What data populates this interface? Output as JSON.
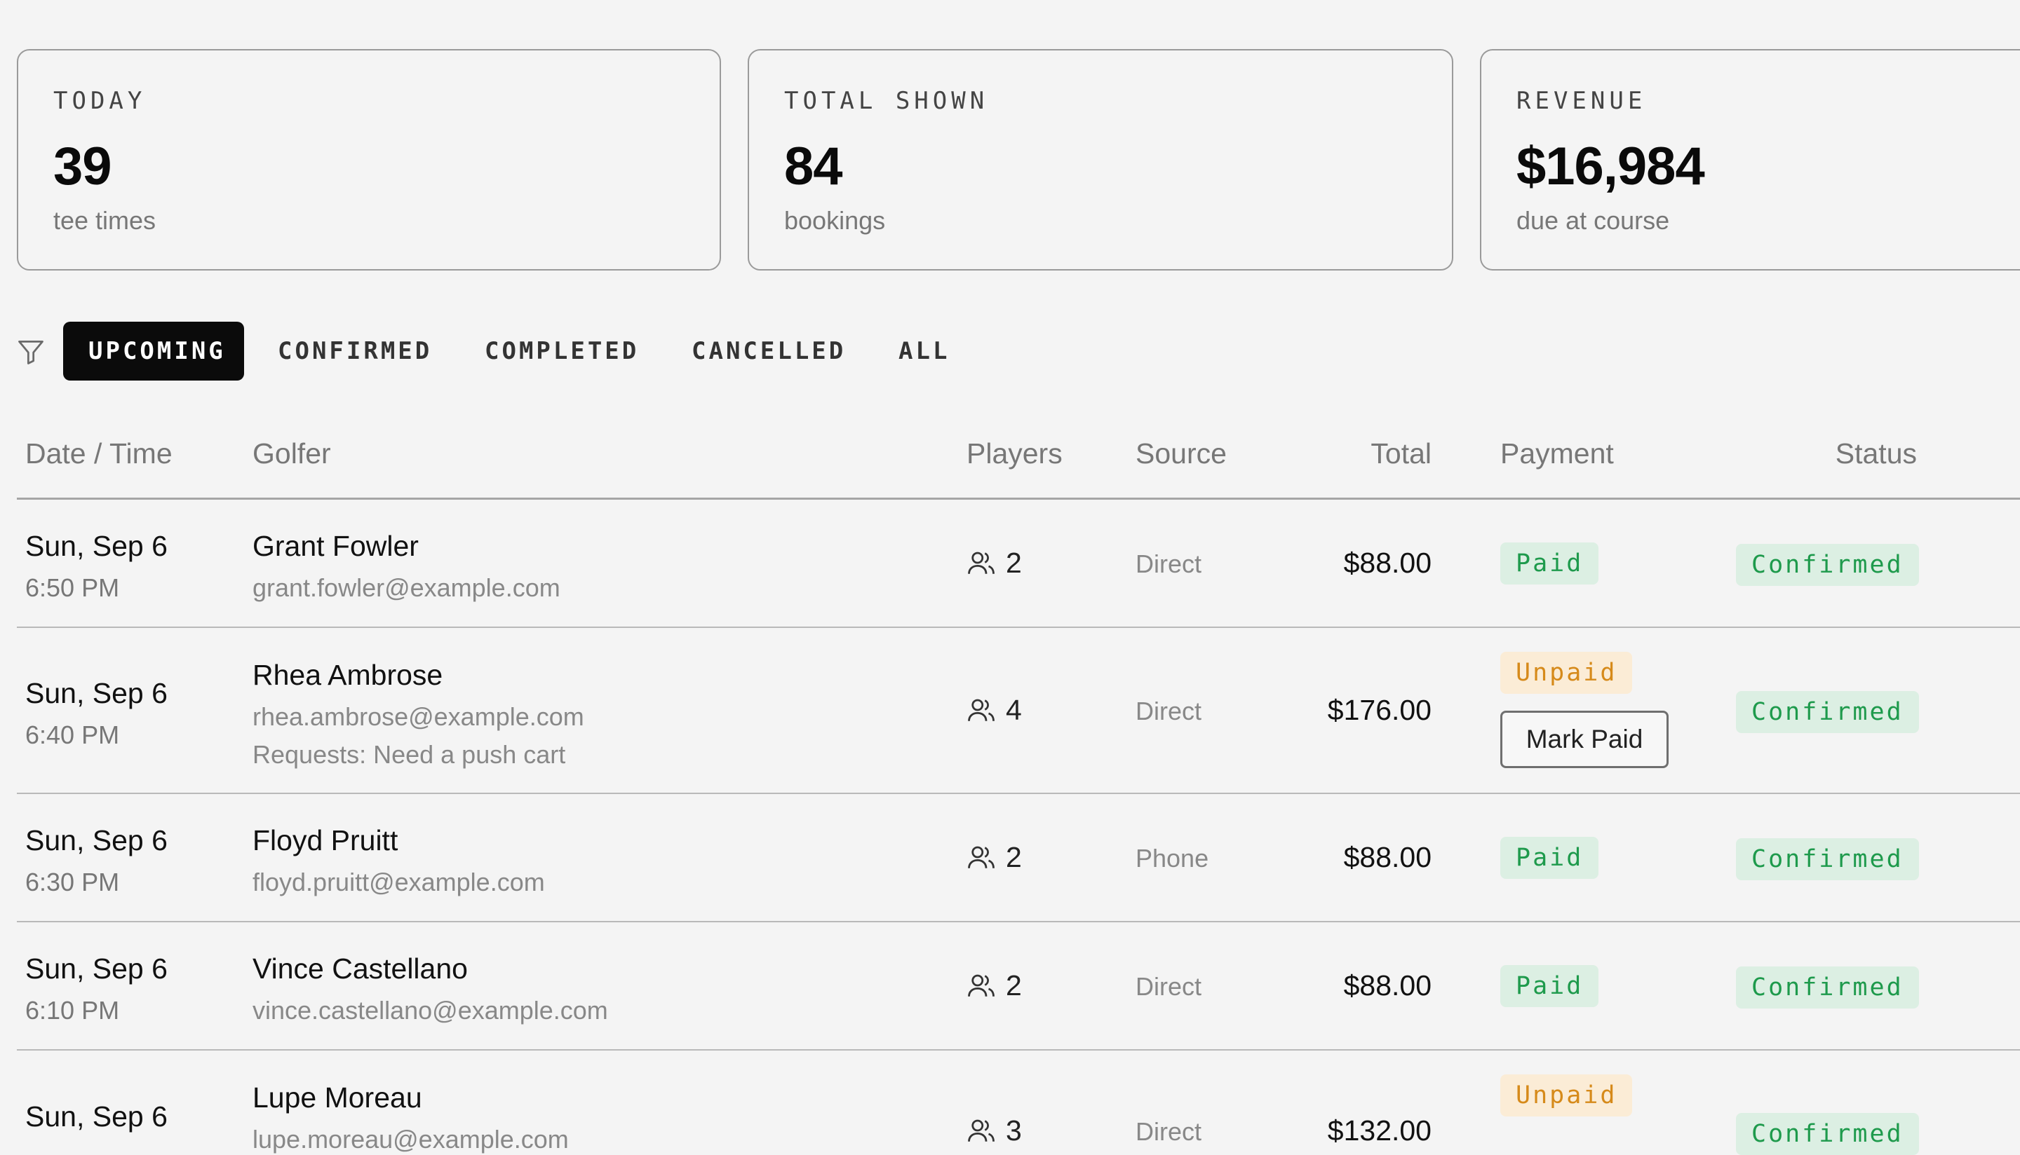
{
  "stats": [
    {
      "label": "TODAY",
      "value": "39",
      "sub": "tee times"
    },
    {
      "label": "TOTAL SHOWN",
      "value": "84",
      "sub": "bookings"
    },
    {
      "label": "REVENUE",
      "value": "$16,984",
      "sub": "due at course"
    }
  ],
  "filters": {
    "icon": "filter-icon",
    "tabs": [
      "UPCOMING",
      "CONFIRMED",
      "COMPLETED",
      "CANCELLED",
      "ALL"
    ],
    "active": "UPCOMING"
  },
  "table": {
    "headers": {
      "datetime": "Date / Time",
      "golfer": "Golfer",
      "players": "Players",
      "source": "Source",
      "total": "Total",
      "payment": "Payment",
      "status": "Status"
    },
    "rows": [
      {
        "date": "Sun, Sep 6",
        "time": "6:50 PM",
        "name": "Grant Fowler",
        "email": "grant.fowler@example.com",
        "note": "",
        "players": "2",
        "source": "Direct",
        "total": "$88.00",
        "payment": "Paid",
        "status": "Confirmed",
        "action": ""
      },
      {
        "date": "Sun, Sep 6",
        "time": "6:40 PM",
        "name": "Rhea Ambrose",
        "email": "rhea.ambrose@example.com",
        "note": "Requests: Need a push cart",
        "players": "4",
        "source": "Direct",
        "total": "$176.00",
        "payment": "Unpaid",
        "status": "Confirmed",
        "action": "Mark Paid"
      },
      {
        "date": "Sun, Sep 6",
        "time": "6:30 PM",
        "name": "Floyd Pruitt",
        "email": "floyd.pruitt@example.com",
        "note": "",
        "players": "2",
        "source": "Phone",
        "total": "$88.00",
        "payment": "Paid",
        "status": "Confirmed",
        "action": ""
      },
      {
        "date": "Sun, Sep 6",
        "time": "6:10 PM",
        "name": "Vince Castellano",
        "email": "vince.castellano@example.com",
        "note": "",
        "players": "2",
        "source": "Direct",
        "total": "$88.00",
        "payment": "Paid",
        "status": "Confirmed",
        "action": ""
      },
      {
        "date": "Sun, Sep 6",
        "time": "",
        "name": "Lupe Moreau",
        "email": "lupe.moreau@example.com",
        "note": "",
        "players": "3",
        "source": "Direct",
        "total": "$132.00",
        "payment": "Unpaid",
        "status": "Confirmed",
        "action": ""
      }
    ]
  },
  "colors": {
    "paid_bg": "#dcefe3",
    "paid_fg": "#1e9a4c",
    "unpaid_bg": "#fbecd6",
    "unpaid_fg": "#d68a1a",
    "active_tab_bg": "#0b0b0b"
  }
}
